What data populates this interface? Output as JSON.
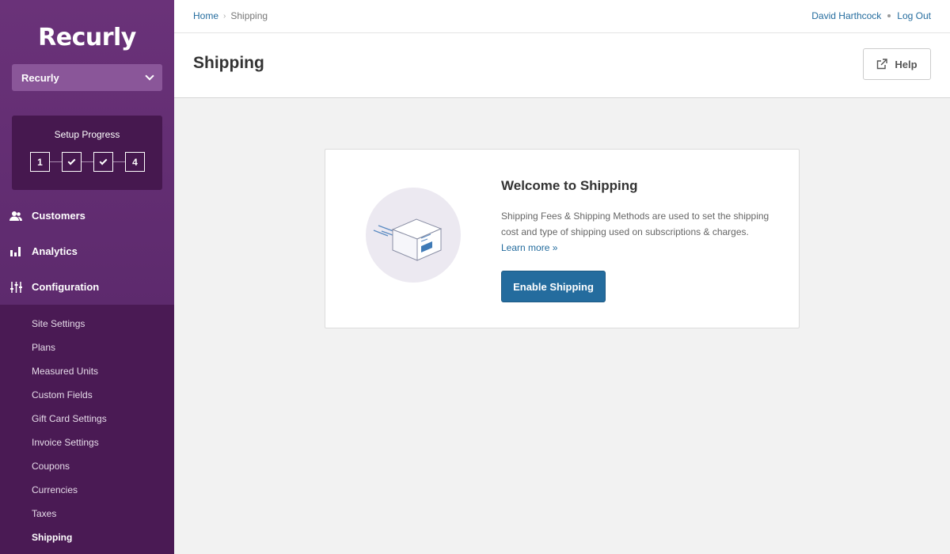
{
  "sidebar": {
    "logo": "Recurly",
    "site_select": "Recurly",
    "setup": {
      "title": "Setup Progress",
      "steps": [
        "1",
        "check",
        "check",
        "4"
      ]
    },
    "main_nav": [
      {
        "label": "Customers",
        "icon": "users-icon"
      },
      {
        "label": "Analytics",
        "icon": "bar-chart-icon"
      },
      {
        "label": "Configuration",
        "icon": "sliders-icon"
      }
    ],
    "sub_nav": [
      {
        "label": "Site Settings"
      },
      {
        "label": "Plans"
      },
      {
        "label": "Measured Units"
      },
      {
        "label": "Custom Fields"
      },
      {
        "label": "Gift Card Settings"
      },
      {
        "label": "Invoice Settings"
      },
      {
        "label": "Coupons"
      },
      {
        "label": "Currencies"
      },
      {
        "label": "Taxes"
      },
      {
        "label": "Shipping",
        "active": true
      }
    ]
  },
  "header": {
    "breadcrumb": {
      "home": "Home",
      "current": "Shipping"
    },
    "user_name": "David Harthcock",
    "logout": "Log Out"
  },
  "page": {
    "title": "Shipping",
    "help_label": "Help"
  },
  "card": {
    "title": "Welcome to Shipping",
    "text": "Shipping Fees & Shipping Methods are used to set the shipping cost and type of shipping used on subscriptions & charges.",
    "learn_more": "Learn more »",
    "button": "Enable Shipping",
    "illustration": "shipping-box-icon"
  },
  "colors": {
    "sidebar": "#5e2a6e",
    "subnav": "#4a1a54",
    "accent": "#246c9e"
  }
}
